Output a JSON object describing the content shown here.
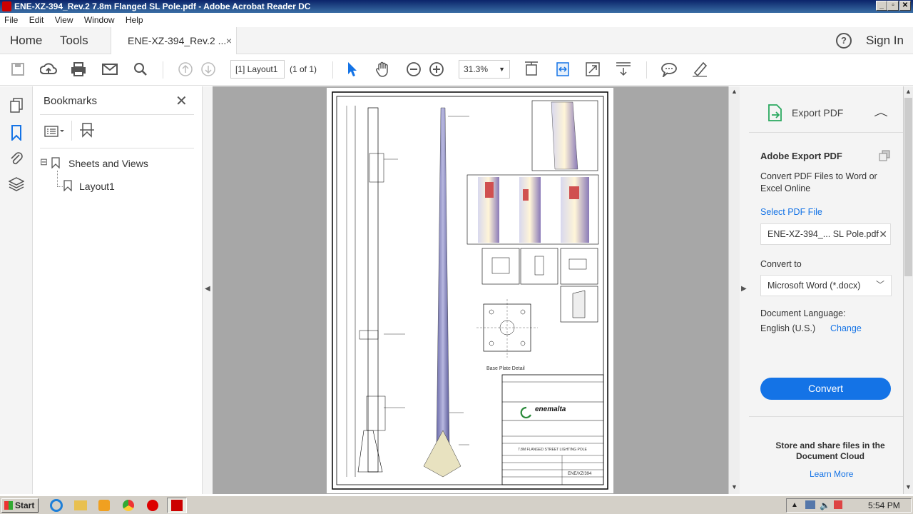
{
  "window": {
    "title": "ENE-XZ-394_Rev.2  7.8m Flanged SL Pole.pdf - Adobe Acrobat Reader DC",
    "min": "_",
    "restore": "▫",
    "close": "✕"
  },
  "menu": [
    "File",
    "Edit",
    "View",
    "Window",
    "Help"
  ],
  "tabs": {
    "home": "Home",
    "tools": "Tools",
    "document": "ENE-XZ-394_Rev.2 ...",
    "close": "×",
    "sign_in": "Sign In",
    "help": "?"
  },
  "toolbar": {
    "page_field": "[1] Layout1",
    "page_count": "(1 of 1)",
    "zoom": "31.3%"
  },
  "bookmarks": {
    "title": "Bookmarks",
    "close": "✕",
    "tree": [
      {
        "label": "Sheets and Views",
        "toggle": "⊟"
      },
      {
        "label": "Layout1"
      }
    ]
  },
  "drawing": {
    "logo": "enemalta",
    "base_plate": "Base  Plate  Detail",
    "title_line": "7.8M FLANGED STREET LIGHTING POLE",
    "drawing_no": "ENE/XZ/394"
  },
  "export_panel": {
    "header": "Export PDF",
    "heading": "Adobe Export PDF",
    "description": "Convert PDF Files to Word or Excel Online",
    "select_label": "Select PDF File",
    "file_name": "ENE-XZ-394_... SL Pole.pdf",
    "convert_to_label": "Convert to",
    "format": "Microsoft Word (*.docx)",
    "language_label": "Document Language:",
    "language": "English (U.S.)",
    "change": "Change",
    "convert_button": "Convert",
    "store_text": "Store and share files in the Document Cloud",
    "learn_more": "Learn More"
  },
  "taskbar": {
    "start": "Start",
    "time": "5:54 PM"
  },
  "colors": {
    "accent": "#1473e6",
    "titlebar": "#0b246a",
    "doc_background": "#a7a7a7",
    "logo_green": "#2a8a3a"
  }
}
